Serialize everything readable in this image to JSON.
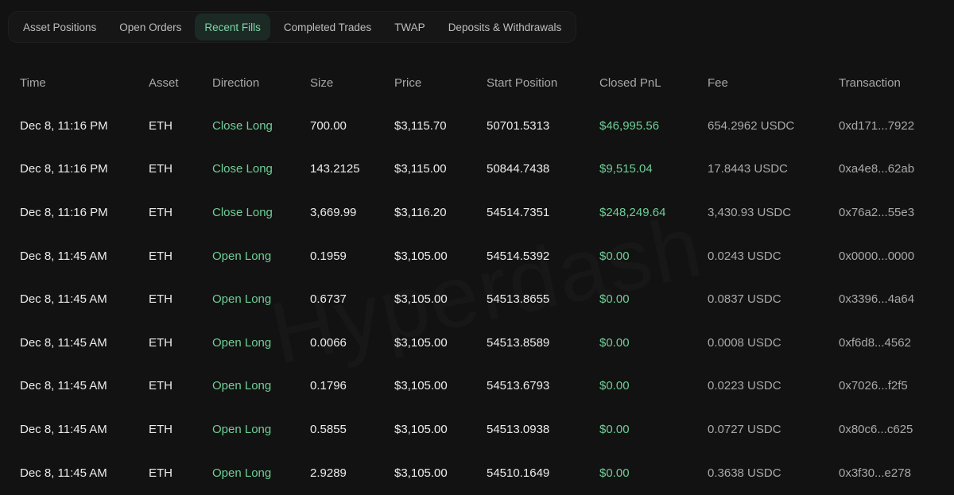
{
  "tabs": [
    {
      "label": "Asset Positions",
      "active": false
    },
    {
      "label": "Open Orders",
      "active": false
    },
    {
      "label": "Recent Fills",
      "active": true
    },
    {
      "label": "Completed Trades",
      "active": false
    },
    {
      "label": "TWAP",
      "active": false
    },
    {
      "label": "Deposits & Withdrawals",
      "active": false
    }
  ],
  "table": {
    "headers": [
      "Time",
      "Asset",
      "Direction",
      "Size",
      "Price",
      "Start Position",
      "Closed PnL",
      "Fee",
      "Transaction"
    ],
    "rows": [
      [
        "Dec 8, 11:16 PM",
        "ETH",
        "Close Long",
        "700.00",
        "$3,115.70",
        "50701.5313",
        "$46,995.56",
        "654.2962 USDC",
        "0xd171...7922"
      ],
      [
        "Dec 8, 11:16 PM",
        "ETH",
        "Close Long",
        "143.2125",
        "$3,115.00",
        "50844.7438",
        "$9,515.04",
        "17.8443 USDC",
        "0xa4e8...62ab"
      ],
      [
        "Dec 8, 11:16 PM",
        "ETH",
        "Close Long",
        "3,669.99",
        "$3,116.20",
        "54514.7351",
        "$248,249.64",
        "3,430.93 USDC",
        "0x76a2...55e3"
      ],
      [
        "Dec 8, 11:45 AM",
        "ETH",
        "Open Long",
        "0.1959",
        "$3,105.00",
        "54514.5392",
        "$0.00",
        "0.0243 USDC",
        "0x0000...0000"
      ],
      [
        "Dec 8, 11:45 AM",
        "ETH",
        "Open Long",
        "0.6737",
        "$3,105.00",
        "54513.8655",
        "$0.00",
        "0.0837 USDC",
        "0x3396...4a64"
      ],
      [
        "Dec 8, 11:45 AM",
        "ETH",
        "Open Long",
        "0.0066",
        "$3,105.00",
        "54513.8589",
        "$0.00",
        "0.0008 USDC",
        "0xf6d8...4562"
      ],
      [
        "Dec 8, 11:45 AM",
        "ETH",
        "Open Long",
        "0.1796",
        "$3,105.00",
        "54513.6793",
        "$0.00",
        "0.0223 USDC",
        "0x7026...f2f5"
      ],
      [
        "Dec 8, 11:45 AM",
        "ETH",
        "Open Long",
        "0.5855",
        "$3,105.00",
        "54513.0938",
        "$0.00",
        "0.0727 USDC",
        "0x80c6...c625"
      ],
      [
        "Dec 8, 11:45 AM",
        "ETH",
        "Open Long",
        "2.9289",
        "$3,105.00",
        "54510.1649",
        "$0.00",
        "0.3638 USDC",
        "0x3f30...e278"
      ]
    ]
  },
  "colors": {
    "background": "#121212",
    "accent_green": "#6fcf97",
    "active_tab_bg": "#1b2a25",
    "active_tab_text": "#7fd6a9",
    "header_text": "#a8a8a8",
    "muted_text": "#a9a9a9"
  },
  "watermark": "Hyperdash"
}
